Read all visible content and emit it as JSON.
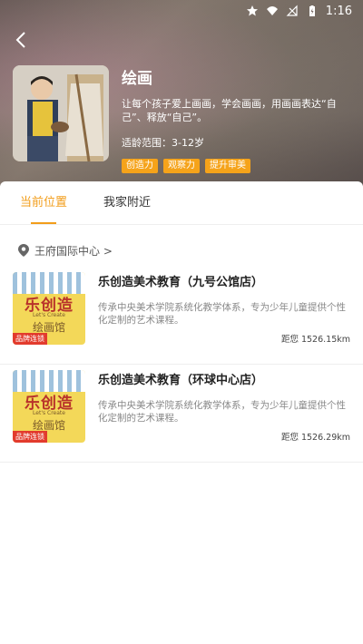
{
  "status_bar": {
    "time": "1:16"
  },
  "header": {
    "title": "绘画",
    "description": "让每个孩子爱上画画，学会画画，用画画表达“自己”、释放“自己”。",
    "age_range": "适龄范围：3-12岁",
    "tags": [
      "创造力",
      "观察力",
      "提升审美"
    ]
  },
  "tabs": [
    {
      "label": "当前位置",
      "active": true
    },
    {
      "label": "我家附近",
      "active": false
    }
  ],
  "location": {
    "text": "王府国际中心 >"
  },
  "schools": [
    {
      "name": "乐创造美术教育（九号公馆店）",
      "description": "传承中央美术学院系统化教学体系，专为少年儿童提供个性化定制的艺术课程。",
      "distance": "距您 1526.15km",
      "logo_main": "乐创造",
      "logo_sub": "Let's Create",
      "logo_hall": "绘画馆",
      "badge": "品牌连锁"
    },
    {
      "name": "乐创造美术教育（环球中心店）",
      "description": "传承中央美术学院系统化教学体系，专为少年儿童提供个性化定制的艺术课程。",
      "distance": "距您 1526.29km",
      "logo_main": "乐创造",
      "logo_sub": "Let's Create",
      "logo_hall": "绘画馆",
      "badge": "品牌连锁"
    }
  ],
  "colors": {
    "accent": "#f29d1a",
    "tag": "#f5a31a",
    "badge": "#e23b2d"
  }
}
